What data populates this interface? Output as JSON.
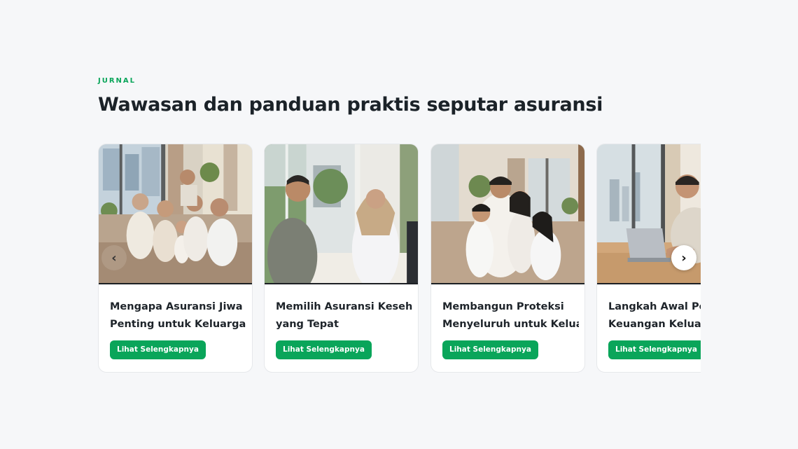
{
  "section": {
    "eyebrow": "JURNAL",
    "heading": "Wawasan dan panduan praktis seputar asuransi"
  },
  "carousel": {
    "prev_icon": "chevron-left-icon",
    "prev_glyph": "‹",
    "next_icon": "chevron-right-icon",
    "next_glyph": "›"
  },
  "articles": [
    {
      "title_line1": "Mengapa Asuransi Jiwa",
      "title_line2": "Penting untuk Keluarga",
      "button": "Lihat Selengkapnya",
      "image": "extended-family-on-sofa-photo"
    },
    {
      "title_line1": "Memilih Asuransi Kesehatan",
      "title_line2": "yang Tepat",
      "button": "Lihat Selengkapnya",
      "image": "man-with-doctor-consultation-photo"
    },
    {
      "title_line1": "Membangun Proteksi",
      "title_line2": "Menyeluruh untuk Keluarga",
      "button": "Lihat Selengkapnya",
      "image": "family-hugging-photo"
    },
    {
      "title_line1": "Langkah Awal Perencanaan",
      "title_line2": "Keuangan Keluarga",
      "button": "Lihat Selengkapnya",
      "image": "man-with-laptop-photo"
    }
  ],
  "colors": {
    "accent": "#0aa55a",
    "background": "#f6f7f9",
    "heading": "#1b2228"
  }
}
